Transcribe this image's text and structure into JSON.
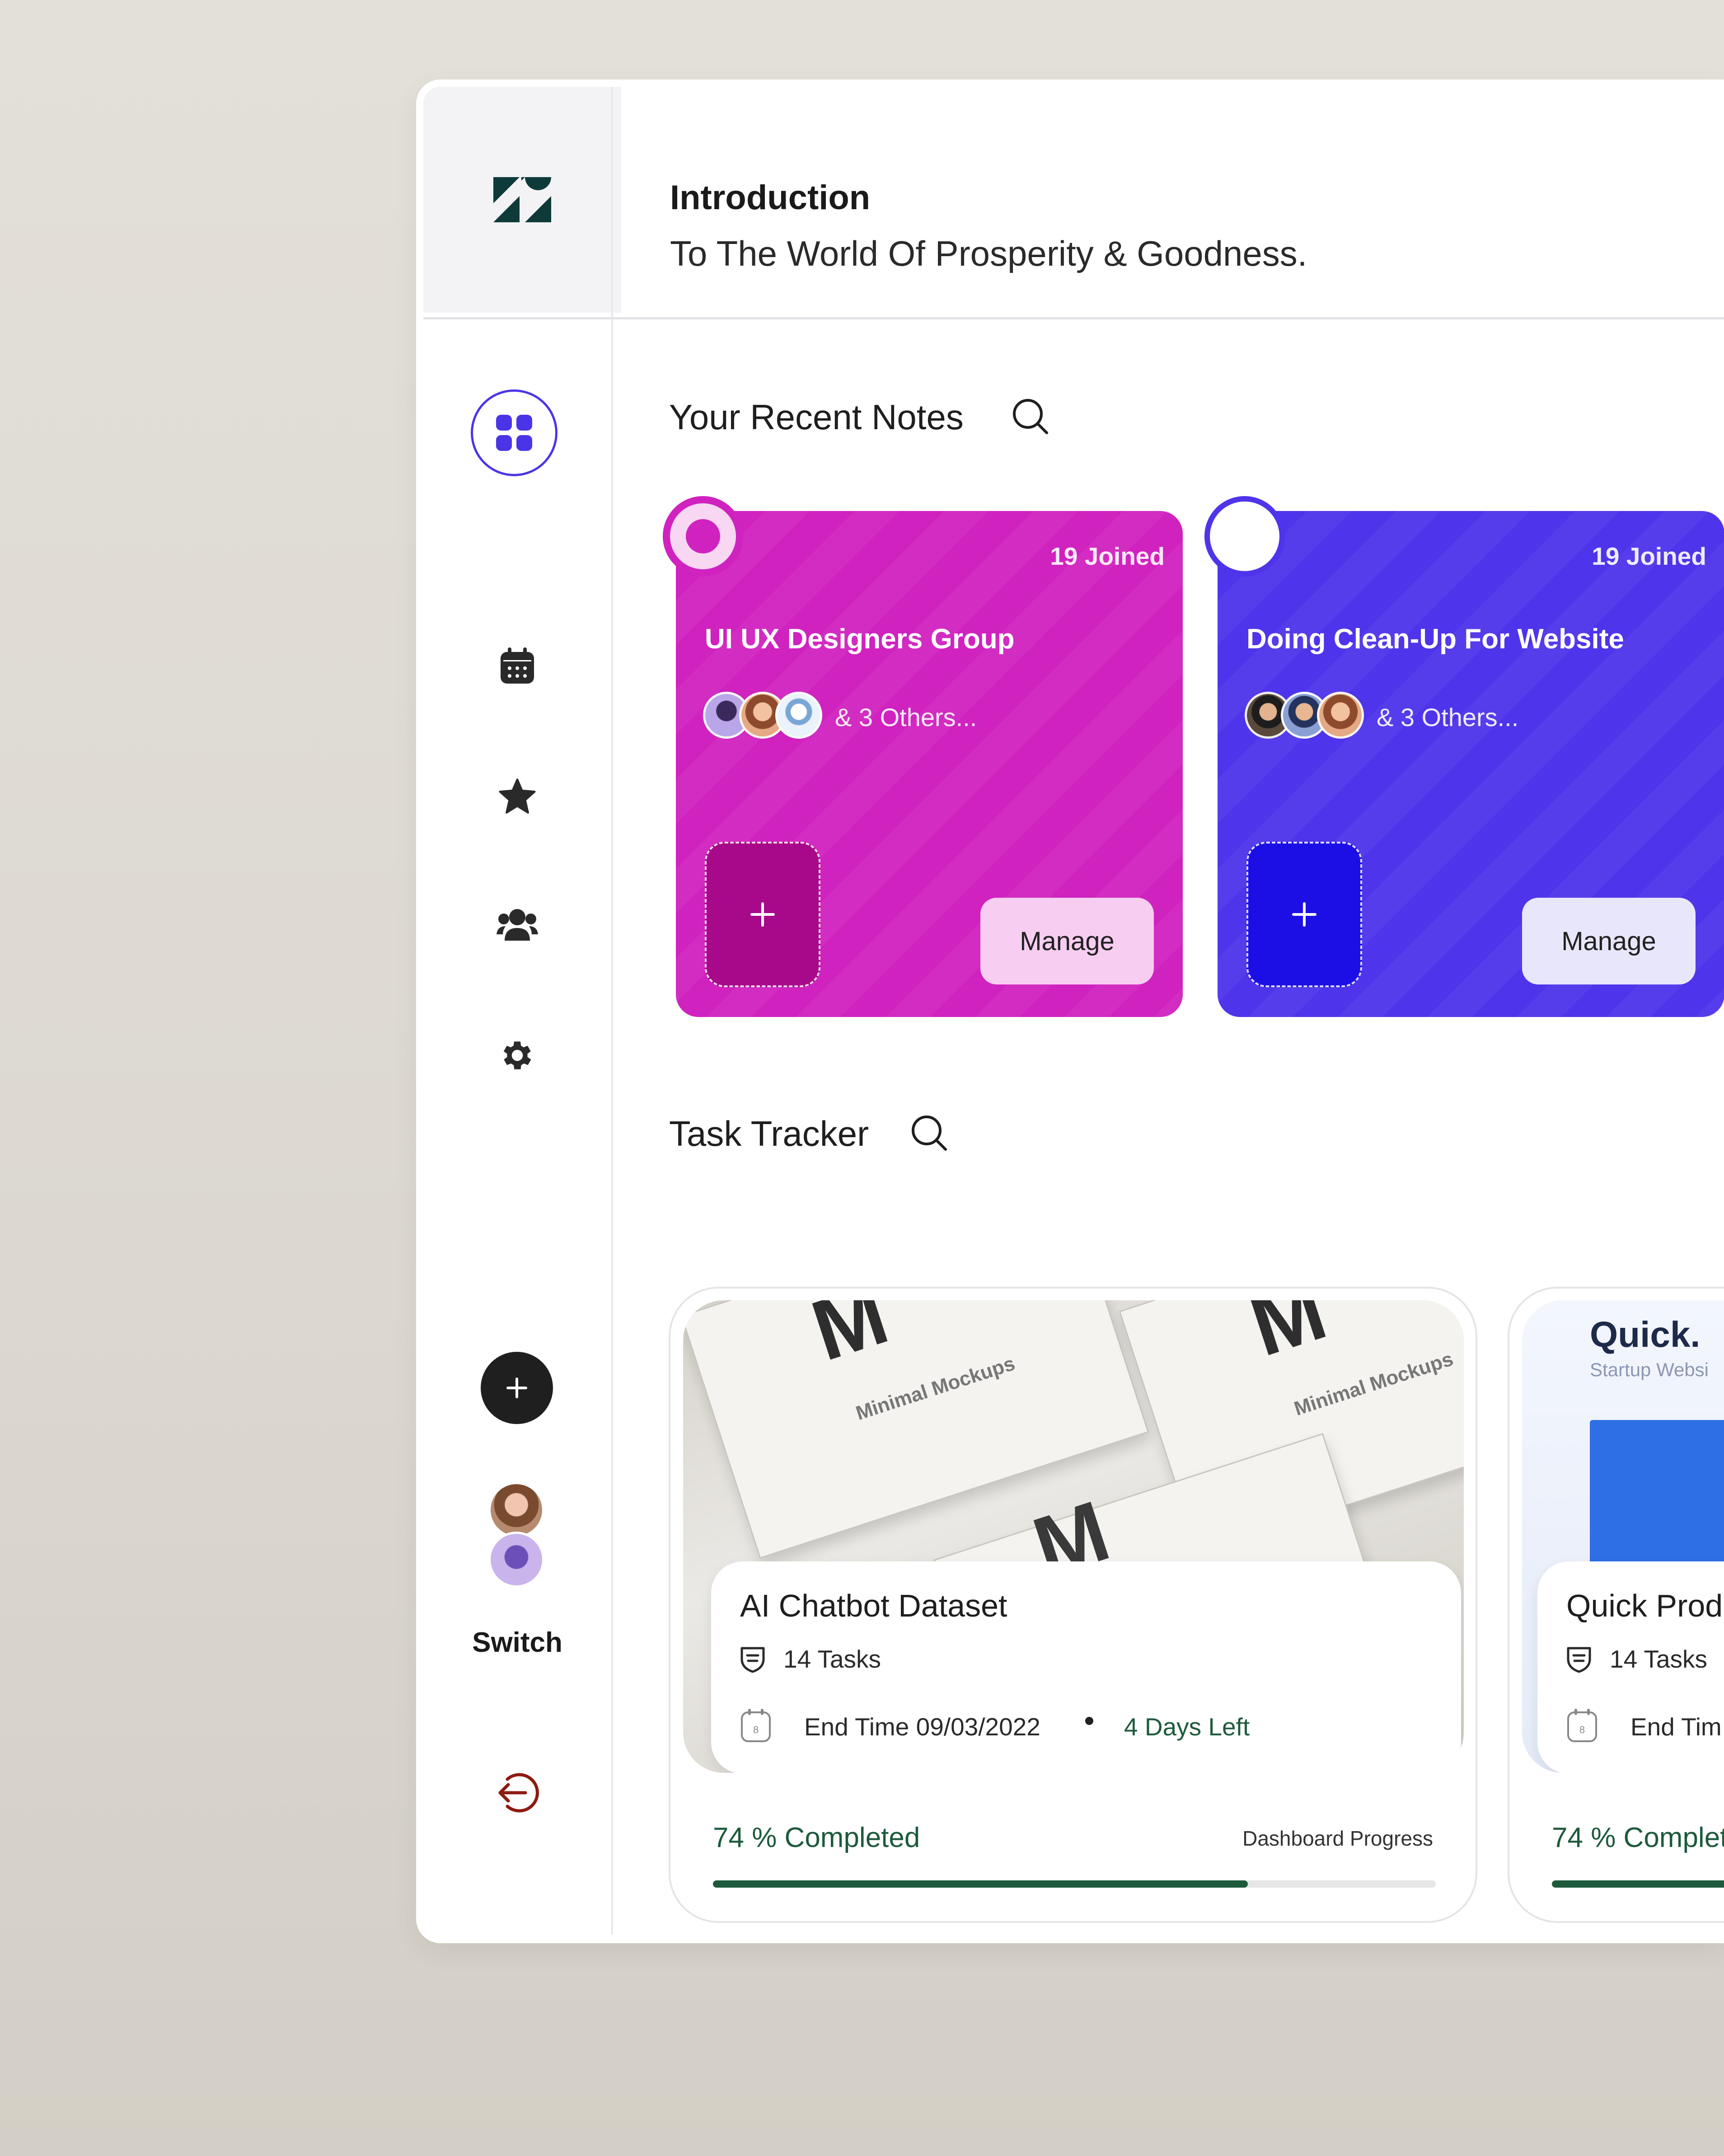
{
  "header": {
    "title": "Introduction",
    "subtitle": "To The World Of Prosperity & Goodness."
  },
  "sidebar": {
    "items": [
      {
        "icon": "dashboard-icon",
        "active": true
      },
      {
        "icon": "calendar-icon"
      },
      {
        "icon": "star-icon"
      },
      {
        "icon": "users-icon"
      },
      {
        "icon": "gear-icon"
      }
    ],
    "switch_label": "Switch",
    "colors": {
      "active": "#4a34e8",
      "logout": "#8c1a10"
    }
  },
  "notes": {
    "title": "Your Recent Notes",
    "cards": [
      {
        "joined": "19 Joined",
        "title": "UI UX Designers Group",
        "others": "& 3 Others...",
        "manage": "Manage",
        "color": "#d022bf"
      },
      {
        "joined": "19 Joined",
        "title": "Doing Clean-Up For Website",
        "others": "& 3 Others...",
        "manage": "Manage",
        "color": "#4e34ea"
      }
    ]
  },
  "tasks": {
    "title": "Task Tracker",
    "cards": [
      {
        "title": "AI Chatbot Dataset",
        "tasks": "14 Tasks",
        "end_time": "End Time  09/03/2022",
        "days_left": "4 Days Left",
        "completed": "74 % Completed",
        "progress_label": "Dashboard Progress",
        "progress": 0.74,
        "image_text": "Minimal Mockups"
      },
      {
        "title": "Quick Prod",
        "tasks": "14 Tasks",
        "end_time": "End Tim",
        "completed": "74 % Complete",
        "progress": 0.74,
        "image_brand": "Quick.",
        "image_sub": "Startup Websi"
      }
    ]
  }
}
